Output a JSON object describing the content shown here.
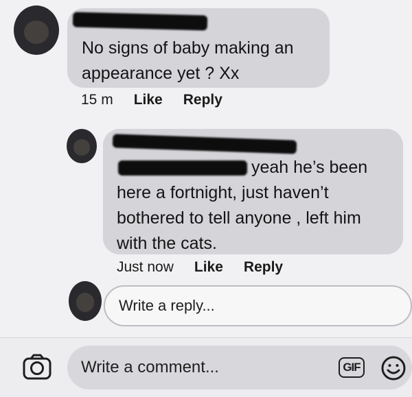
{
  "comments": [
    {
      "author": "",
      "text": "No signs of baby making an appearance yet ? Xx",
      "time": "15 m",
      "like_label": "Like",
      "reply_label": "Reply"
    }
  ],
  "replies": [
    {
      "author": "",
      "mention": "",
      "text": "yeah he’s been here a fortnight, just haven’t bothered to tell anyone , left him with the cats.",
      "time": "Just now",
      "like_label": "Like",
      "reply_label": "Reply"
    }
  ],
  "reply_input": {
    "placeholder": "Write a reply..."
  },
  "comment_bar": {
    "placeholder": "Write a comment...",
    "camera_icon": "camera-icon",
    "gif_label": "GIF",
    "emoji_icon": "smiley-icon"
  }
}
